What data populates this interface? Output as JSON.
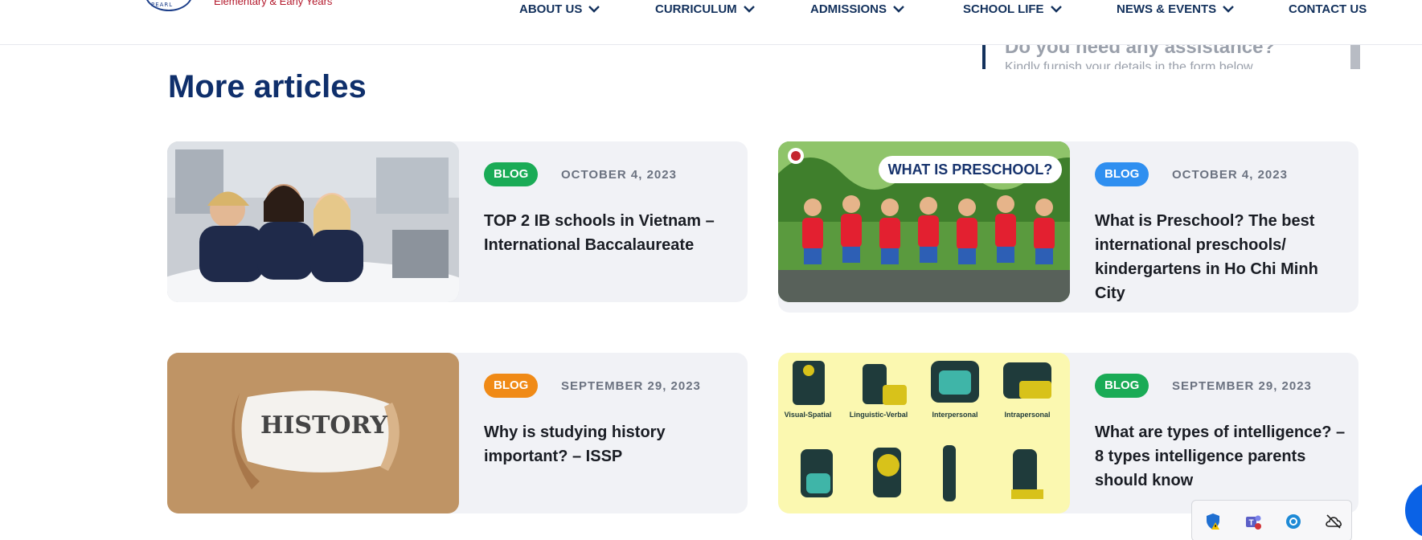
{
  "header": {
    "logo_seal_text": "SAIGON PEARL",
    "logo_tagline": "Elementary & Early Years",
    "nav": [
      {
        "label": "ABOUT US"
      },
      {
        "label": "CURRICULUM"
      },
      {
        "label": "ADMISSIONS"
      },
      {
        "label": "SCHOOL LIFE"
      },
      {
        "label": "NEWS & EVENTS"
      },
      {
        "label": "CONTACT US"
      }
    ]
  },
  "assist": {
    "title": "Do you need any assistance?",
    "subtitle": "Kindly furnish your details in the form below"
  },
  "section": {
    "title": "More articles"
  },
  "articles": [
    {
      "badge": "BLOG",
      "badge_color": "#1aab56",
      "date": "OCTOBER 4, 2023",
      "title": "TOP 2 IB schools in Vietnam – International Baccalaureate",
      "image": "children-studying-photo"
    },
    {
      "badge": "BLOG",
      "badge_color": "#2f8ff0",
      "date": "OCTOBER 4, 2023",
      "title": "What is Preschool? The best international preschools/ kindergartens in Ho Chi Minh City",
      "image": "preschool-kids-photo",
      "image_caption": "WHAT IS PRESCHOOL?"
    },
    {
      "badge": "BLOG",
      "badge_color": "#f08a16",
      "date": "SEPTEMBER 29, 2023",
      "title": "Why is studying history important? – ISSP",
      "image": "torn-paper-history-photo",
      "image_caption": "HISTORY"
    },
    {
      "badge": "BLOG",
      "badge_color": "#1aab56",
      "date": "SEPTEMBER 29, 2023",
      "title": "What are types of intelligence? – 8 types intelligence parents should know",
      "image": "intelligence-types-illustration",
      "image_labels": [
        "Visual-Spatial",
        "Linguistic-Verbal",
        "Interpersonal",
        "Intrapersonal"
      ]
    }
  ],
  "tray": {
    "icons": [
      "defender-warning-icon",
      "teams-icon",
      "app-icon",
      "cloud-offline-icon"
    ]
  },
  "colors": {
    "nav_text": "#13315c",
    "title_text": "#0f2f6b",
    "card_bg": "#f1f2f6"
  }
}
